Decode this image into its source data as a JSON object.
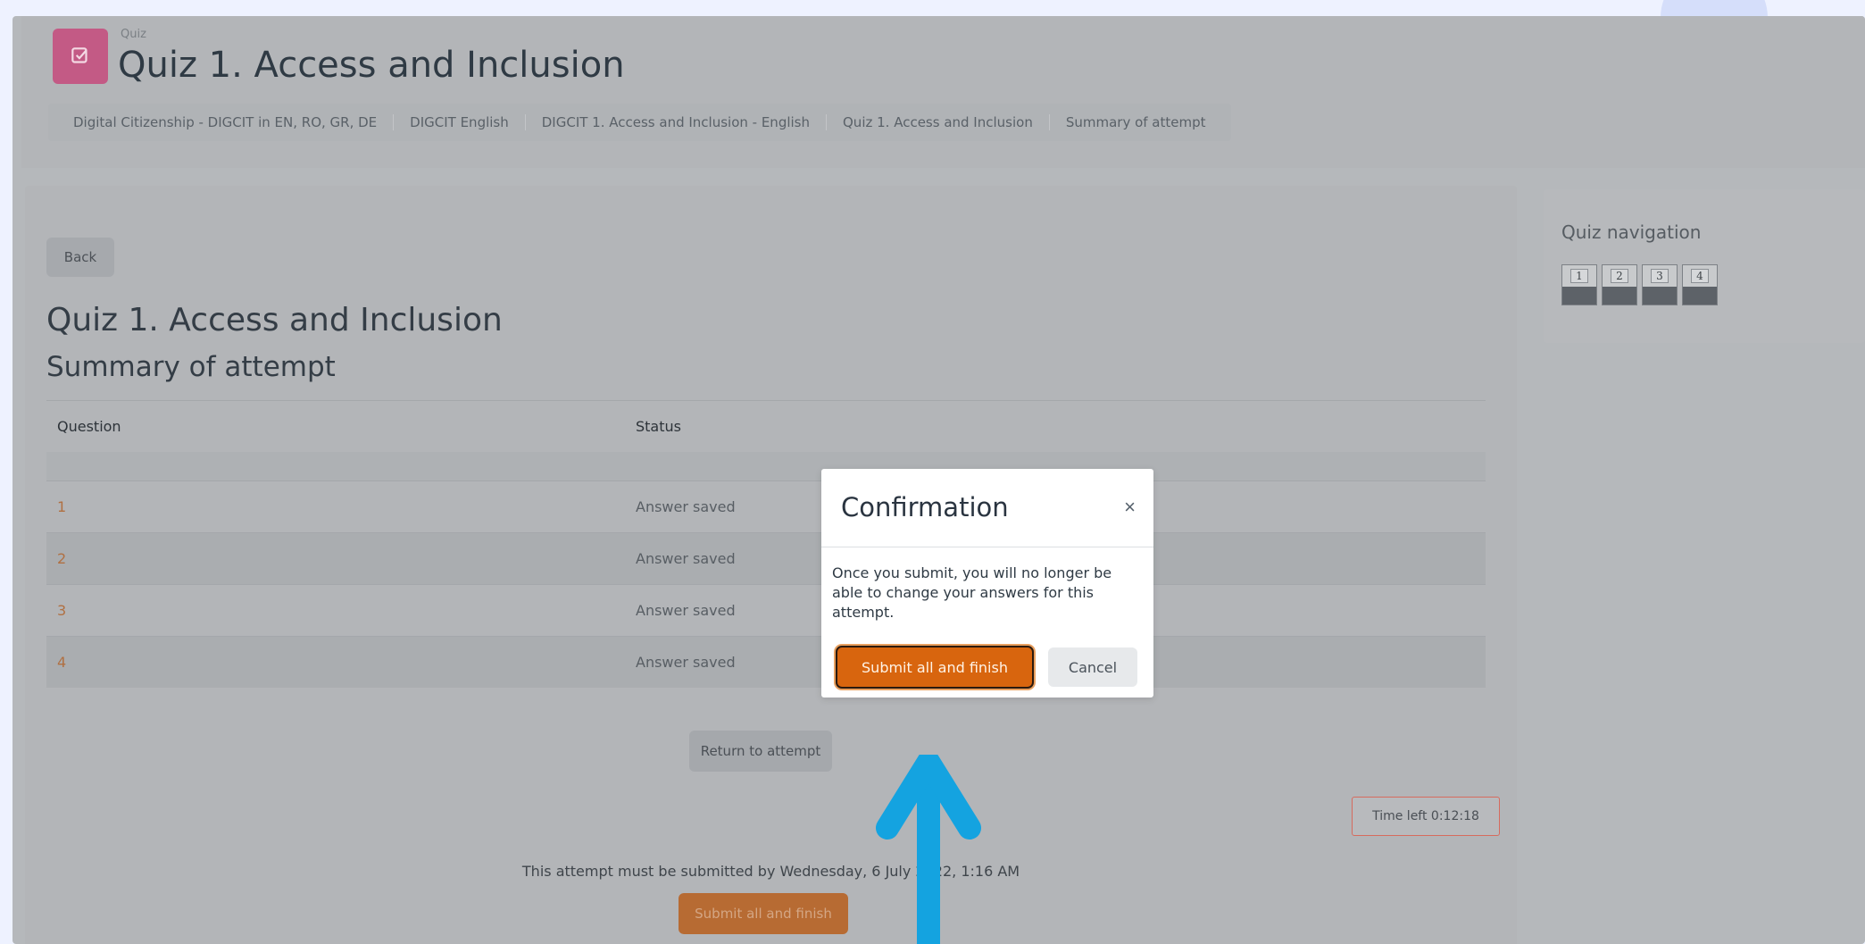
{
  "header": {
    "module_label": "Quiz",
    "page_heading": "Quiz 1. Access and Inclusion",
    "breadcrumb": [
      "Digital Citizenship - DIGCIT in EN, RO, GR, DE",
      "DIGCIT English",
      "DIGCIT 1. Access and Inclusion - English",
      "Quiz 1. Access and Inclusion",
      "Summary of attempt"
    ]
  },
  "main": {
    "back_label": "Back",
    "quiz_title": "Quiz 1. Access and Inclusion",
    "summary_title": "Summary of attempt",
    "table": {
      "headers": [
        "Question",
        "Status"
      ],
      "rows": [
        {
          "question": "1",
          "status": "Answer saved"
        },
        {
          "question": "2",
          "status": "Answer saved"
        },
        {
          "question": "3",
          "status": "Answer saved"
        },
        {
          "question": "4",
          "status": "Answer saved"
        }
      ]
    },
    "return_label": "Return to attempt",
    "time_left": "Time left 0:12:18",
    "deadline_text": "This attempt must be submitted by Wednesday, 6 July 2022, 1:16 AM",
    "submit_label": "Submit all and finish"
  },
  "quiz_nav": {
    "title": "Quiz navigation",
    "questions": [
      "1",
      "2",
      "3",
      "4"
    ]
  },
  "modal": {
    "title": "Confirmation",
    "close_symbol": "×",
    "body": "Once you submit, you will no longer be able to change your answers for this attempt.",
    "submit_label": "Submit all and finish",
    "cancel_label": "Cancel"
  },
  "colors": {
    "accent_orange": "#d8650e",
    "quiz_icon": "#c35a85",
    "arrow_blue": "#14a3e0"
  }
}
